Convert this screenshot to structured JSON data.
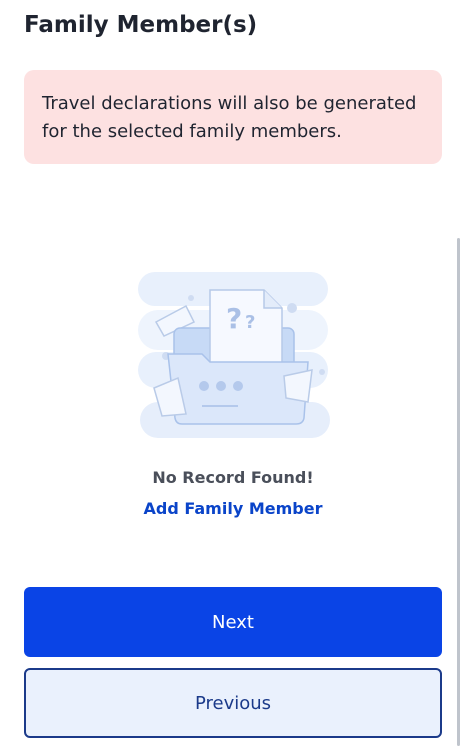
{
  "header": {
    "title": "Family Member(s)"
  },
  "notice": {
    "text": "Travel declarations will also be generated for the selected family members."
  },
  "empty_state": {
    "message": "No Record Found!",
    "add_link": "Add Family Member",
    "illustration_icon": "empty-folder-question-icon"
  },
  "actions": {
    "next_label": "Next",
    "previous_label": "Previous"
  },
  "colors": {
    "primary": "#0a44e6",
    "link": "#0a44c9",
    "notice_bg": "#fde1e1",
    "secondary_bg": "#eaf1fd",
    "secondary_border": "#1b3a8a"
  }
}
